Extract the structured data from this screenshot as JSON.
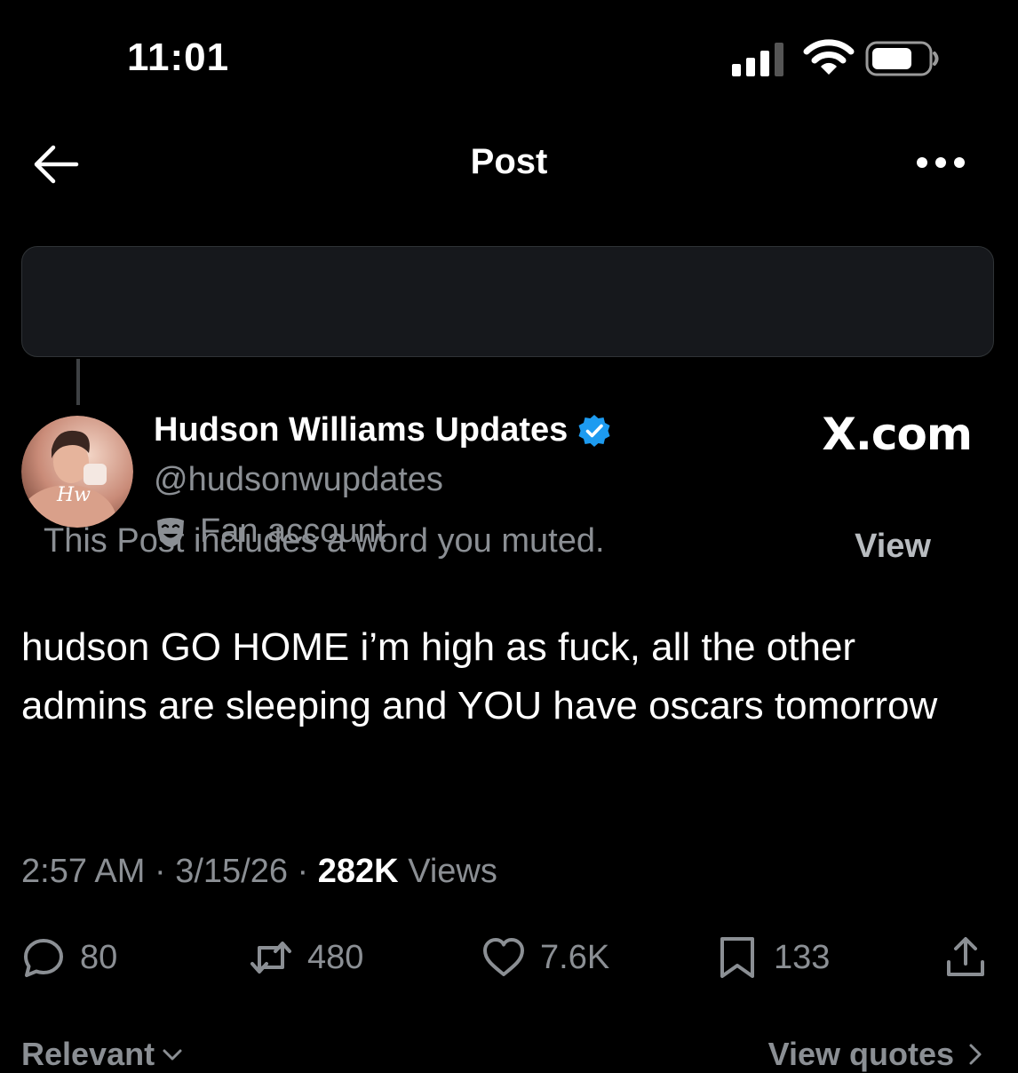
{
  "status_bar": {
    "time": "11:01",
    "icons": [
      "signal-icon",
      "wifi-icon",
      "battery-icon"
    ]
  },
  "header": {
    "title": "Post",
    "back_icon": "back-arrow-icon",
    "more_icon": "more-options-icon"
  },
  "muted_notice": {
    "text": "This Post includes a word you muted.",
    "action_label": "View"
  },
  "author": {
    "name": "Hudson Williams Updates",
    "handle": "@hudsonwupdates",
    "badge_label": "Fan account",
    "badge_icon": "theater-mask-icon",
    "verified": true,
    "verified_color": "#1d9bf0"
  },
  "watermark": "X.com",
  "post": {
    "text": "hudson GO HOME i’m high as fuck, all the other admins are sleeping and YOU have oscars tomorrow",
    "time": "2:57 AM",
    "date": "3/15/26",
    "views_count": "282K",
    "views_label": "Views"
  },
  "actions": {
    "replies": "80",
    "reposts": "480",
    "likes": "7.6K",
    "bookmarks": "133"
  },
  "footer": {
    "sort_label": "Relevant",
    "quotes_label": "View quotes"
  },
  "colors": {
    "background": "#000000",
    "primary_text": "#ffffff",
    "secondary_text": "#8b8f94",
    "banner_bg": "#16181c",
    "accent": "#1d9bf0"
  }
}
